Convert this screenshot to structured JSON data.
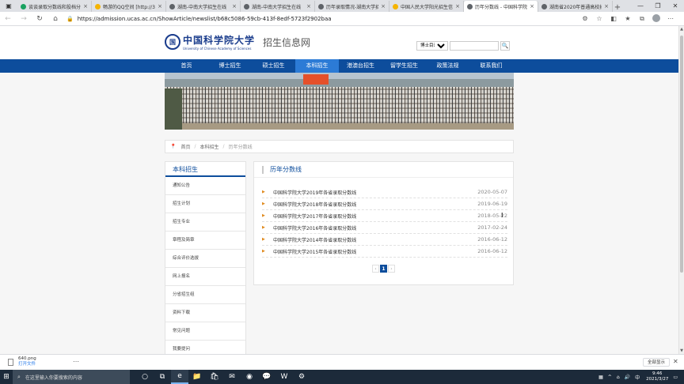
{
  "browser": {
    "tabs": [
      {
        "label": "谈谈录取分数线和投档分数",
        "color": "#1aa260",
        "active": false
      },
      {
        "label": "畅游的QQ空间 [http://311",
        "color": "#f5b400",
        "active": false
      },
      {
        "label": "湖南-中南大学招生在线",
        "color": "#5f6368",
        "active": false
      },
      {
        "label": "湖南-中南大学招生在线",
        "color": "#5f6368",
        "active": false
      },
      {
        "label": "历年录取情况-湖南大学招",
        "color": "#5f6368",
        "active": false
      },
      {
        "label": "中国人民大学阳光招生信息",
        "color": "#f5b400",
        "active": false
      },
      {
        "label": "历年分数线 - 中国科学院大",
        "color": "#5f6368",
        "active": true
      },
      {
        "label": "湖南省2020年普通高校招",
        "color": "#5f6368",
        "active": false
      }
    ],
    "tab_close": "×",
    "new_tab": "+",
    "url": "https://admission.ucas.ac.cn/ShowArticle/newslist/b68c5086-59cb-413f-8edf-5723f2902baa"
  },
  "site": {
    "logo_cn": "中国科学院大学",
    "logo_en": "University of Chinese Academy of Sciences",
    "site_name": "招生信息网",
    "search_select": "博士目录",
    "search_placeholder": ""
  },
  "nav": [
    {
      "label": "首页",
      "active": false
    },
    {
      "label": "博士招生",
      "active": false
    },
    {
      "label": "硕士招生",
      "active": false
    },
    {
      "label": "本科招生",
      "active": true
    },
    {
      "label": "港澳台招生",
      "active": false
    },
    {
      "label": "留学生招生",
      "active": false
    },
    {
      "label": "政策法规",
      "active": false
    },
    {
      "label": "联系我们",
      "active": false
    }
  ],
  "breadcrumb": {
    "home": "首页",
    "section": "本科招生",
    "current": "历年分数线",
    "separator": "/"
  },
  "sidebar": {
    "title": "本科招生",
    "items": [
      "通知公告",
      "招生计划",
      "招生专业",
      "章程及简章",
      "综合评价选拔",
      "网上报名",
      "分省招生组",
      "资料下载",
      "常见问题",
      "我要提问"
    ]
  },
  "content": {
    "title": "历年分数线",
    "rows": [
      {
        "title": "中国科学院大学2019年各省录取分数线",
        "date": "2020-05-07"
      },
      {
        "title": "中国科学院大学2018年各省录取分数线",
        "date": "2019-06-19"
      },
      {
        "title": "中国科学院大学2017年各省录取分数线",
        "date": "2018-05-22"
      },
      {
        "title": "中国科学院大学2016年各省录取分数线",
        "date": "2017-02-24"
      },
      {
        "title": "中国科学院大学2014年各省录取分数线",
        "date": "2016-06-12"
      },
      {
        "title": "中国科学院大学2015年各省录取分数线",
        "date": "2016-06-12"
      }
    ],
    "pager": {
      "prev": "‹",
      "current": "1",
      "next": "›"
    }
  },
  "download": {
    "file_name": "640.png",
    "open_label": "打开文件",
    "show_all": "全部显示"
  },
  "taskbar": {
    "search_placeholder": "在这里输入你要搜索的内容",
    "time": "9:46",
    "date": "2021/3/27"
  }
}
